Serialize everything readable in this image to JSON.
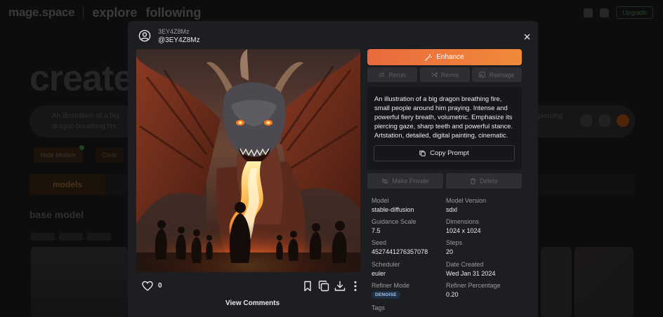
{
  "background": {
    "brand": "mage.space",
    "nav_links": [
      "explore",
      "following"
    ],
    "upgrade_label": "Upgrade",
    "heading": "create",
    "prompt_left": "An illustration of a big dragon breathing fire, small people around him praying. Intense and powerful fiery breath, volumetric. Emphasize its piercing gaze, sharp teeth and",
    "prompt_right": "piercing",
    "chip_left": "Hide Models",
    "chip_right": "Clear",
    "tab_active": "models",
    "section_title": "base model"
  },
  "modal": {
    "username": "3EY4Z8Mz",
    "handle": "@3EY4Z8Mz",
    "like_count": "0",
    "view_comments": "View Comments",
    "buttons": {
      "enhance": "Enhance",
      "rerun": "Rerun",
      "remix": "Remix",
      "reimage": "Reimage",
      "make_private": "Make Private",
      "delete": "Delete",
      "copy_prompt": "Copy Prompt"
    },
    "prompt": "An illustration of a big dragon breathing fire, small people around him praying. Intense and powerful fiery breath, volumetric. Emphasize its piercing gaze, sharp teeth and powerful stance. Artstation, detailed, digital painting, cinematic.",
    "metadata": {
      "model_label": "Model",
      "model": "stable-diffusion",
      "model_version_label": "Model Version",
      "model_version": "sdxl",
      "guidance_label": "Guidance Scale",
      "guidance": "7.5",
      "dimensions_label": "Dimensions",
      "dimensions": "1024 x 1024",
      "seed_label": "Seed",
      "seed": "4527441276357078",
      "steps_label": "Steps",
      "steps": "20",
      "scheduler_label": "Scheduler",
      "scheduler": "euler",
      "date_label": "Date Created",
      "date": "Wed Jan 31 2024",
      "refiner_mode_label": "Refiner Mode",
      "refiner_mode": "DENOISE",
      "refiner_pct_label": "Refiner Percentage",
      "refiner_pct": "0.20",
      "tags_label": "Tags"
    }
  },
  "colors": {
    "accent": "#f07a3c",
    "modal_bg": "#1d1e22",
    "badge_bg": "#1f3146"
  }
}
